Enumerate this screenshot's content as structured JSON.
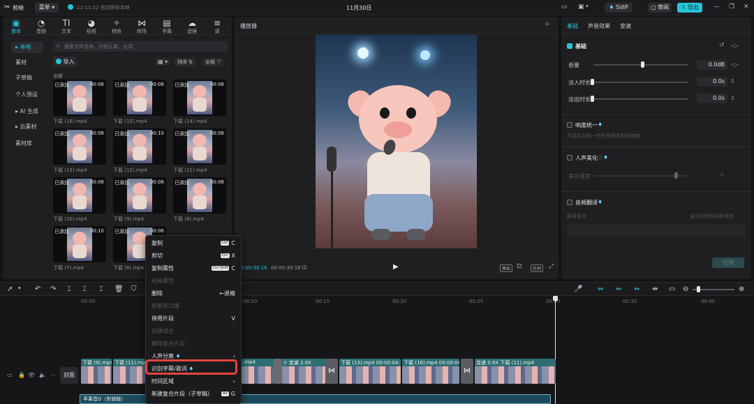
{
  "titlebar": {
    "app_name": "剪映",
    "menu_label": "菜单",
    "autosave": "22:11:22 自动保存本地",
    "project_title": "11月30日",
    "svip_label": "SVIP",
    "review_label": "审阅",
    "export_label": "导出"
  },
  "media_tabs": [
    {
      "label": "媒体",
      "icon": "▣"
    },
    {
      "label": "音频",
      "icon": "◔"
    },
    {
      "label": "文本",
      "icon": "TI"
    },
    {
      "label": "贴纸",
      "icon": "◕"
    },
    {
      "label": "特效",
      "icon": "✧"
    },
    {
      "label": "转场",
      "icon": "⋈"
    },
    {
      "label": "字幕",
      "icon": "▤"
    },
    {
      "label": "滤镜",
      "icon": "☁"
    },
    {
      "label": "调",
      "icon": "≡"
    }
  ],
  "sidebar": {
    "items": [
      "本地",
      "素材",
      "子草稿",
      "个人预设",
      "AI 生成",
      "云素材",
      "素材库"
    ]
  },
  "media": {
    "search_placeholder": "搜索文件名称、识别元素、台词",
    "import_label": "导入",
    "sort_label": "排序",
    "all_filter_label": "全部",
    "section_all": "全部",
    "added_badge": "已添加",
    "items": [
      {
        "name": "下载 (16).mp4",
        "duration": "00:06"
      },
      {
        "name": "下载 (15).mp4",
        "duration": "00:06"
      },
      {
        "name": "下载 (14).mp4",
        "duration": "00:06"
      },
      {
        "name": "下载 (13).mp4",
        "duration": "00:06"
      },
      {
        "name": "下载 (12).mp4",
        "duration": "00:10"
      },
      {
        "name": "下载 (11).mp4",
        "duration": "00:06"
      },
      {
        "name": "下载 (10).mp4",
        "duration": "00:06"
      },
      {
        "name": "下载 (9).mp4",
        "duration": "00:06"
      },
      {
        "name": "下载 (8).mp4",
        "duration": "00:06"
      },
      {
        "name": "下载 (7).mp4",
        "duration": "00:10"
      },
      {
        "name": "下载 (6).mp4",
        "duration": "00:06"
      }
    ]
  },
  "player": {
    "title": "播放器",
    "current_time": "00:00:30:16",
    "total_time": "00:00:30:16",
    "original_label": "原始",
    "ratio_label": "比例"
  },
  "properties": {
    "tabs": [
      "基础",
      "声音效果",
      "变速"
    ],
    "basic_section": "基础",
    "volume_label": "音量",
    "volume_value": "0.0dB",
    "volume_level": 0.5,
    "fade_in_label": "淡入时长",
    "fade_in_value": "0.0s",
    "fade_out_label": "淡出时长",
    "fade_out_value": "0.0s",
    "loudness_label": "响度统一",
    "loudness_desc": "开启后可统一所有音频素材的响度",
    "voice_beauty_label": "人声美化",
    "beauty_strength_label": "美化强度",
    "beauty_value": "0",
    "audio_translate_label": "音频翻译",
    "translate_desc": "翻译语言",
    "translate_value": "自动识别原视频语言",
    "apply_label": "应用"
  },
  "context_menu": {
    "items": [
      {
        "label": "复制",
        "shortcut": "C",
        "key": "Ctrl",
        "disabled": false
      },
      {
        "label": "剪切",
        "shortcut": "X",
        "key": "Ctrl",
        "disabled": false
      },
      {
        "label": "复制属性",
        "shortcut": "C",
        "key": "Ctrl Shift",
        "disabled": false
      },
      {
        "label": "粘贴属性",
        "shortcut": "",
        "key": "",
        "disabled": true
      },
      {
        "label": "删除",
        "shortcut": "←退格",
        "key": "",
        "disabled": false
      },
      {
        "label": "智能剪口播",
        "shortcut": "",
        "key": "",
        "disabled": true
      },
      {
        "label": "停用片段",
        "shortcut": "V",
        "key": "",
        "disabled": false
      },
      {
        "label": "创建组合",
        "shortcut": "",
        "key": "",
        "disabled": true
      },
      {
        "label": "解除复合片段",
        "shortcut": "",
        "key": "",
        "disabled": true
      },
      {
        "label": "人声分离",
        "shortcut": "›",
        "key": "",
        "disabled": false
      },
      {
        "label": "识别字幕/歌词",
        "shortcut": "",
        "key": "",
        "disabled": false
      },
      {
        "label": "时间区域",
        "shortcut": "›",
        "key": "",
        "disabled": false
      },
      {
        "label": "新建复合片段（子草稿）",
        "shortcut": "G",
        "key": "Alt",
        "disabled": false
      }
    ]
  },
  "timeline": {
    "ruler": [
      "00:00",
      "00:10",
      "00:15",
      "00:20",
      "00:25",
      "00:30",
      "00:35",
      "00:40"
    ],
    "cover_label": "封面",
    "audio_track_label": "苹果音D（剪辑版）",
    "clips": [
      {
        "label": "下载 (9).mp4"
      },
      {
        "label": "下载 (11).mp4"
      },
      {
        "label": ".mp4"
      },
      {
        "label": "下载 (13).mp4 00:00:04:11"
      },
      {
        "label": "下载 (16).mp4 00:00:04:10"
      },
      {
        "label": "变速 0.9X 下载 (11).mp4"
      }
    ],
    "speed_badge": "变速 2.0X"
  }
}
